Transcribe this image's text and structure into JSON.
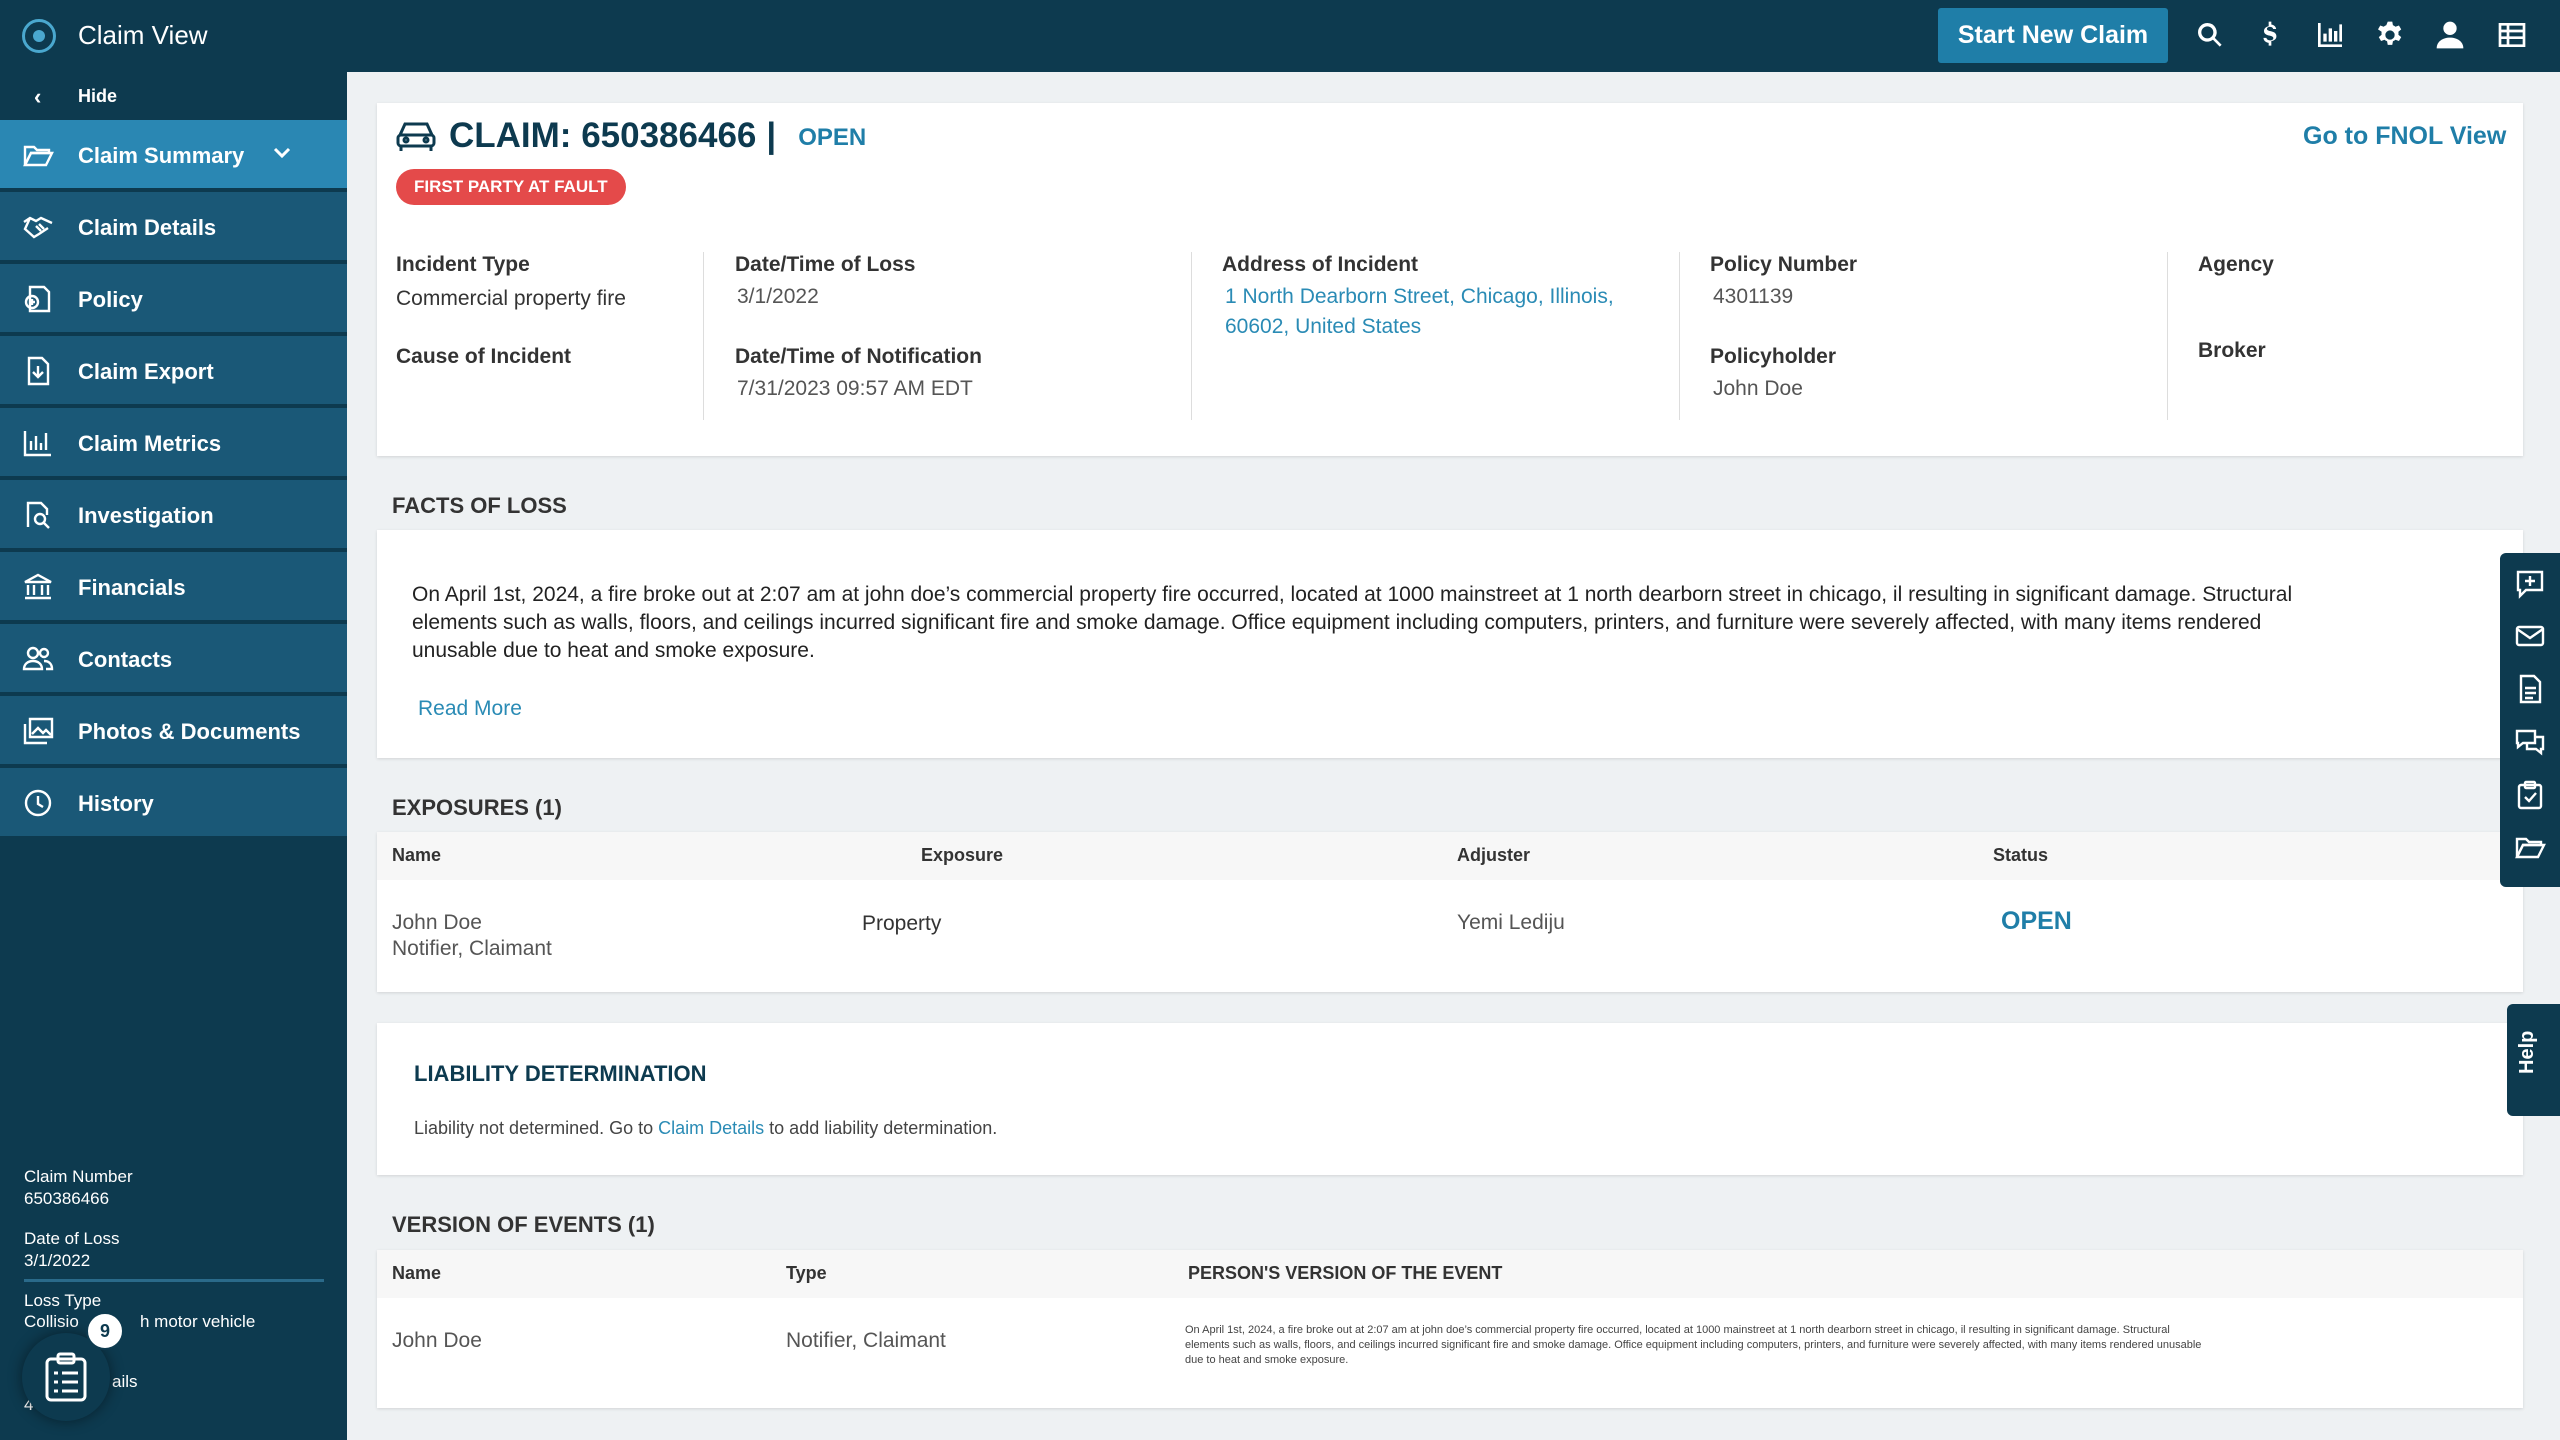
{
  "app": {
    "title": "Claim View",
    "start_new_claim": "Start New Claim"
  },
  "sidebar": {
    "hide_label": "Hide",
    "items": [
      {
        "label": "Claim Summary",
        "icon": "folder-open-icon"
      },
      {
        "label": "Claim Details",
        "icon": "handshake-icon"
      },
      {
        "label": "Policy",
        "icon": "policy-icon"
      },
      {
        "label": "Claim Export",
        "icon": "file-export-icon"
      },
      {
        "label": "Claim Metrics",
        "icon": "bar-chart-icon"
      },
      {
        "label": "Investigation",
        "icon": "document-search-icon"
      },
      {
        "label": "Financials",
        "icon": "bank-icon"
      },
      {
        "label": "Contacts",
        "icon": "users-icon"
      },
      {
        "label": "Photos & Documents",
        "icon": "images-icon"
      },
      {
        "label": "History",
        "icon": "clock-icon"
      }
    ],
    "info": {
      "claim_number_label": "Claim Number",
      "claim_number": "650386466",
      "date_of_loss_label": "Date of Loss",
      "date_of_loss": "3/1/2022",
      "loss_type_label": "Loss Type",
      "loss_type_start": "Collisio",
      "loss_type_end": "h motor vehicle",
      "details_fragment": "ails",
      "bottom_fragment": "4"
    },
    "badge_count": "9"
  },
  "claim": {
    "title": "CLAIM: 650386466",
    "separator": "|",
    "status": "OPEN",
    "fault_badge": "FIRST PARTY AT FAULT",
    "fnol_link": "Go to FNOL View",
    "incident_type_label": "Incident Type",
    "incident_type": "Commercial property fire",
    "cause_label": "Cause of Incident",
    "loss_date_label": "Date/Time of Loss",
    "loss_date": "3/1/2022",
    "notification_label": "Date/Time of Notification",
    "notification": "7/31/2023 09:57 AM EDT",
    "address_label": "Address of Incident",
    "address_line1": "1 North Dearborn Street, Chicago, Illinois,",
    "address_line2": "60602, United States",
    "policy_number_label": "Policy Number",
    "policy_number": "4301139",
    "policyholder_label": "Policyholder",
    "policyholder": "John Doe",
    "agency_label": "Agency",
    "broker_label": "Broker"
  },
  "facts": {
    "title": "FACTS OF LOSS",
    "text": "On April 1st, 2024, a fire broke out at 2:07 am at john doe’s commercial property fire occurred, located at 1000 mainstreet at 1 north dearborn street in chicago, il resulting in significant damage. Structural elements such as walls, floors, and ceilings incurred significant fire and smoke damage. Office equipment including computers, printers, and furniture were severely affected, with many items rendered unusable due to heat and smoke exposure.",
    "read_more": "Read More"
  },
  "exposures": {
    "title": "EXPOSURES (1)",
    "headers": [
      "Name",
      "Exposure",
      "Adjuster",
      "Status"
    ],
    "rows": [
      {
        "name": "John Doe",
        "role": "Notifier, Claimant",
        "exposure": "Property",
        "adjuster": "Yemi Lediju",
        "status": "OPEN"
      }
    ]
  },
  "liability": {
    "title": "LIABILITY DETERMINATION",
    "text_before": "Liability not determined. Go to ",
    "link": "Claim Details",
    "text_after": " to add liability determination."
  },
  "version_events": {
    "title": "VERSION OF EVENTS (1)",
    "headers": [
      "Name",
      "Type",
      "PERSON'S VERSION OF THE EVENT"
    ],
    "rows": [
      {
        "name": "John Doe",
        "type": "Notifier, Claimant",
        "version": "On April 1st, 2024, a fire broke out at 2:07 am at john doe’s commercial property fire occurred, located at 1000 mainstreet at 1 north dearborn street in chicago, il resulting in significant damage. Structural elements such as walls, floors, and ceilings incurred significant fire and smoke damage. Office equipment including computers, printers, and furniture were severely affected, with many items rendered unusable due to heat and smoke exposure."
      }
    ]
  },
  "help_label": "Help",
  "colors": {
    "navy": "#0d3a4f",
    "nav_item": "#1a5877",
    "nav_active": "#2a87b3",
    "accent": "#1f7ea8",
    "fault_red": "#e44a4a"
  }
}
